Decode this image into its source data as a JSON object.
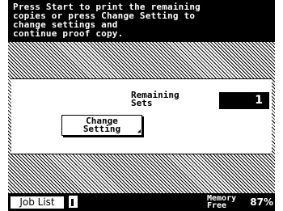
{
  "message": {
    "lines": [
      "Press Start to print the remaining",
      "copies or press Change Setting to",
      "change settings and",
      "continue proof copy."
    ]
  },
  "remaining": {
    "label_lines": [
      "Remaining",
      "Sets"
    ],
    "value": "1"
  },
  "change_button": {
    "label_lines": [
      "Change",
      "Setting"
    ]
  },
  "footer": {
    "job_list_label": "Job List",
    "memory_label_lines": [
      "Memory",
      "Free"
    ],
    "memory_value": "87%",
    "icon": "document-icon"
  },
  "colors": {
    "foreground": "#000000",
    "background": "#ffffff"
  }
}
